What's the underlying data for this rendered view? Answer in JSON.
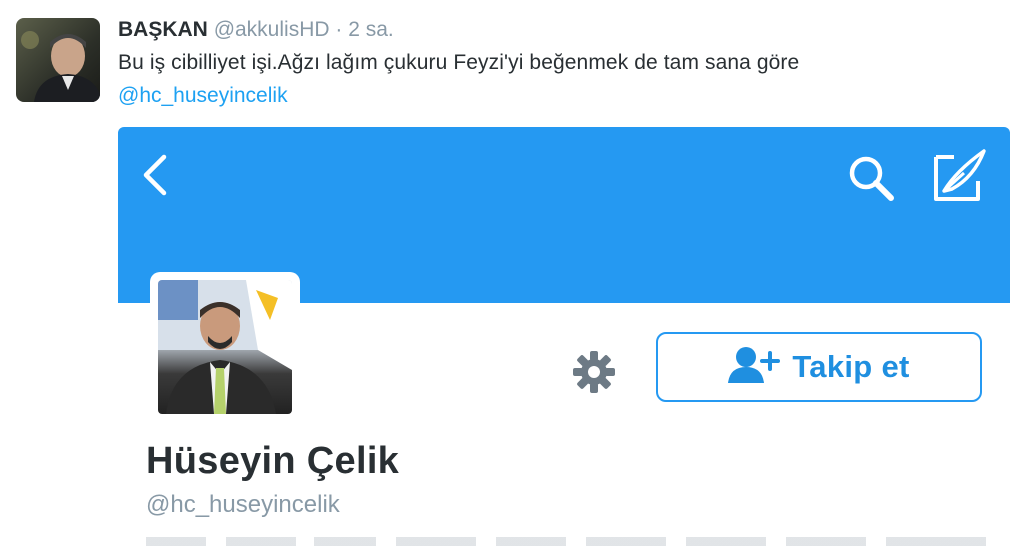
{
  "tweet": {
    "author_name": "BAŞKAN",
    "author_handle": "@akkulisHD",
    "separator": "·",
    "time": "2 sa.",
    "text": "Bu iş cibilliyet işi.Ağzı lağım çukuru Feyzi'yi beğenmek de tam sana göre",
    "mention": "@hc_huseyincelik"
  },
  "embedded_profile": {
    "name": "Hüseyin Çelik",
    "handle": "@hc_huseyincelik",
    "follow_label": "Takip et",
    "banner_color": "#2599f2",
    "accent_color": "#1f8fe0",
    "icons": [
      "back-icon",
      "search-icon",
      "compose-icon",
      "gear-icon",
      "add-user-icon"
    ]
  }
}
